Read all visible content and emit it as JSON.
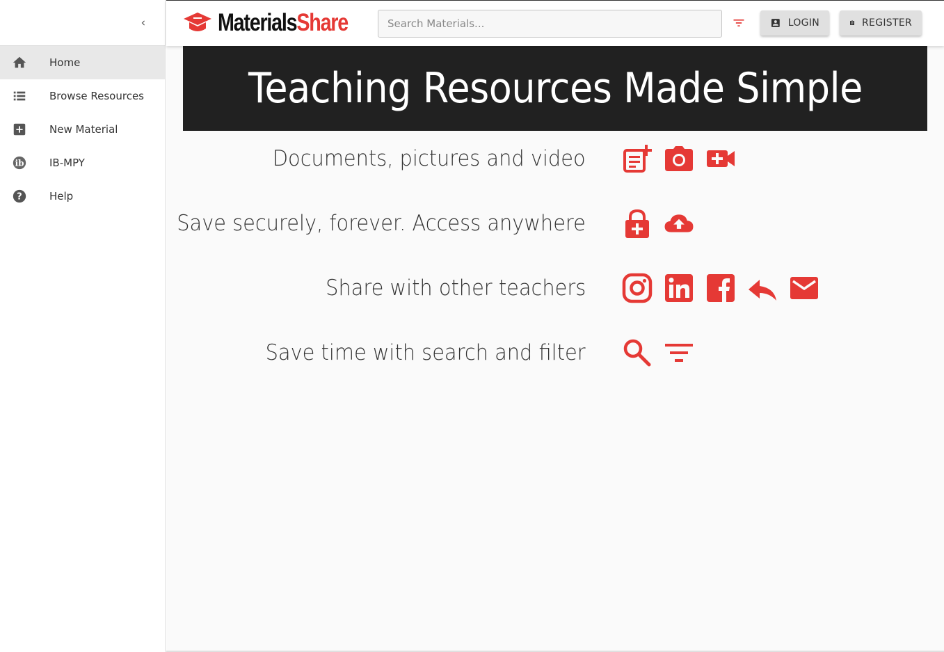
{
  "colors": {
    "accent": "#e53935",
    "banner_bg": "#212121",
    "nav_active_bg": "#e8e8e8"
  },
  "sidebar": {
    "collapse_icon": "chevron-left-icon",
    "items": [
      {
        "label": "Home",
        "icon": "home-icon",
        "active": true
      },
      {
        "label": "Browse Resources",
        "icon": "list-icon"
      },
      {
        "label": "New Material",
        "icon": "add-box-icon"
      },
      {
        "label": "IB-MPY",
        "icon": "ib-logo-icon"
      },
      {
        "label": "Help",
        "icon": "help-icon"
      }
    ]
  },
  "header": {
    "logo_part1": "Materials",
    "logo_part2": "Share",
    "search_placeholder": "Search Materials...",
    "login_label": "LOGIN",
    "register_label": "REGISTER"
  },
  "main": {
    "banner_title": "Teaching Resources Made Simple",
    "features": [
      {
        "text": "Documents, pictures and video",
        "icons": [
          "note-add-icon",
          "camera-icon",
          "video-add-icon"
        ]
      },
      {
        "text": "Save securely, forever. Access anywhere",
        "icons": [
          "lock-add-icon",
          "cloud-upload-icon"
        ]
      },
      {
        "text": "Share with other teachers",
        "icons": [
          "instagram-icon",
          "linkedin-icon",
          "facebook-icon",
          "reply-icon",
          "email-icon"
        ]
      },
      {
        "text": "Save time with search and filter",
        "icons": [
          "search-icon",
          "filter-icon"
        ]
      }
    ]
  }
}
